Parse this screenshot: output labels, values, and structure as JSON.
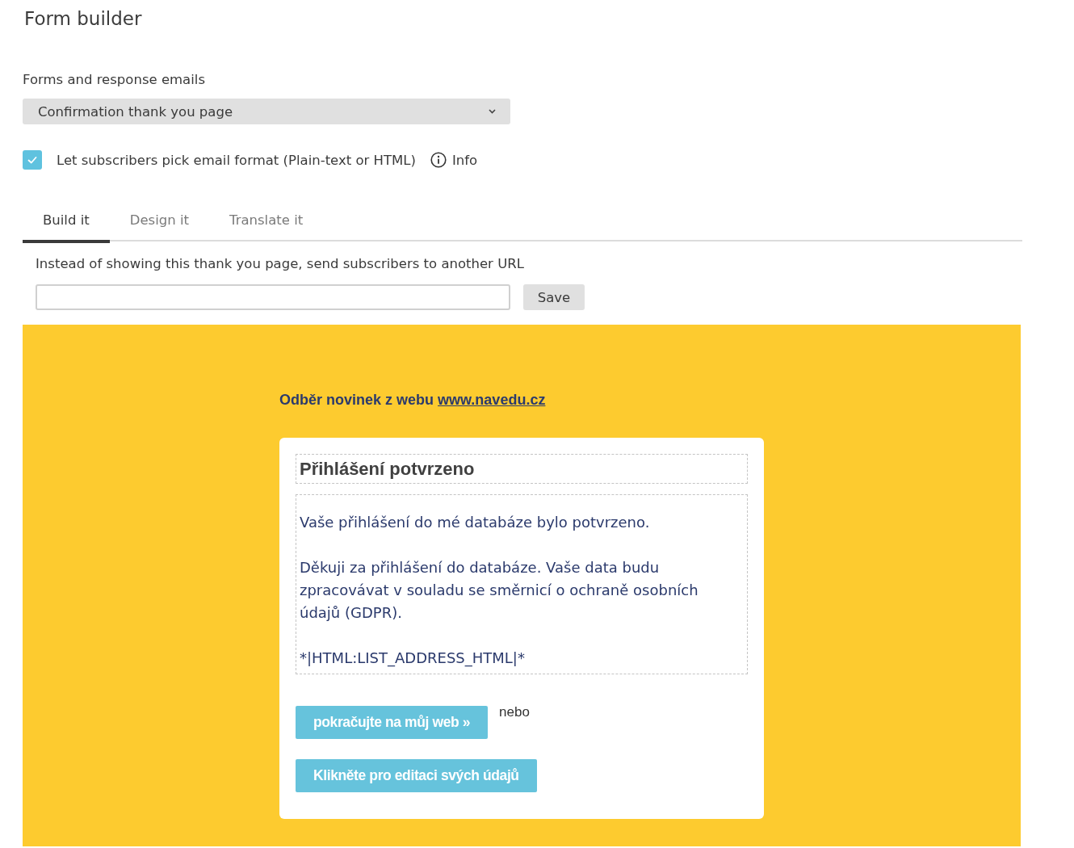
{
  "page": {
    "title": "Form builder"
  },
  "form_selector": {
    "label": "Forms and response emails",
    "value": "Confirmation thank you page"
  },
  "email_format_option": {
    "label": "Let subscribers pick email format (Plain-text or HTML)",
    "checked": true,
    "info_link": "Info"
  },
  "tabs": [
    {
      "label": "Build it",
      "selected": true
    },
    {
      "label": "Design it",
      "selected": false
    },
    {
      "label": "Translate it",
      "selected": false
    }
  ],
  "redirect": {
    "label": "Instead of showing this thank you page, send subscribers to another URL",
    "save_button": "Save"
  },
  "preview": {
    "header": {
      "text": "Odběr novinek z webu",
      "link": "www.navedu.cz"
    },
    "title": "Přihlášení potvrzeno",
    "paragraphs": [
      "Vaše přihlášení do mé databáze bylo potvrzeno.",
      "Děkuji za přihlášení do databáze. Vaše data budu zpracovávat v souladu se směrnicí o ochraně osobních údajů (GDPR).",
      "*|HTML:LIST_ADDRESS_HTML|*"
    ],
    "buttons": [
      {
        "label": "pokračujte na můj web »"
      },
      {
        "label": "Klikněte pro editaci svých údajů"
      }
    ],
    "or_text": "nebo"
  }
}
